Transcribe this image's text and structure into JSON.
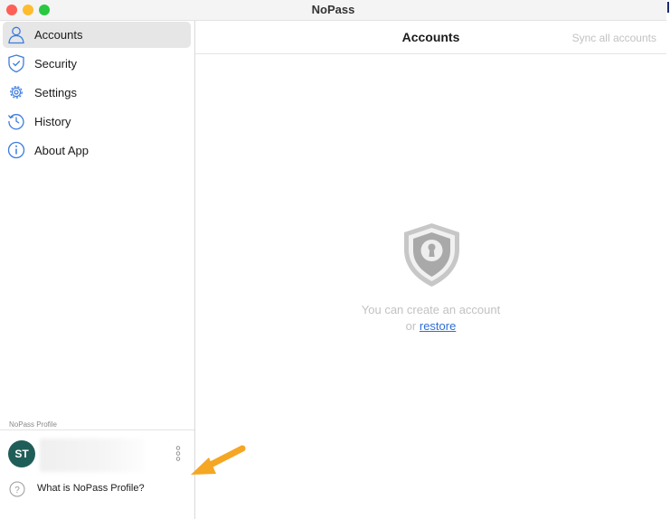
{
  "window": {
    "title": "NoPass"
  },
  "sidebar": {
    "items": [
      {
        "label": "Accounts",
        "icon": "person-icon",
        "active": true
      },
      {
        "label": "Security",
        "icon": "shield-check-icon",
        "active": false
      },
      {
        "label": "Settings",
        "icon": "gear-icon",
        "active": false
      },
      {
        "label": "History",
        "icon": "history-icon",
        "active": false
      },
      {
        "label": "About App",
        "icon": "info-icon",
        "active": false
      }
    ],
    "profile": {
      "caption": "NoPass Profile",
      "initials": "ST",
      "help_label": "What is NoPass Profile?"
    }
  },
  "main": {
    "title": "Accounts",
    "sync_label": "Sync all accounts",
    "empty_state": {
      "line1": "You can create an account",
      "or_text": "or",
      "restore_label": "restore"
    }
  },
  "colors": {
    "accent": "#2f6fd4",
    "icon_blue": "#3b7be0",
    "avatar": "#1f5e58",
    "annotation_arrow": "#f5a623"
  }
}
